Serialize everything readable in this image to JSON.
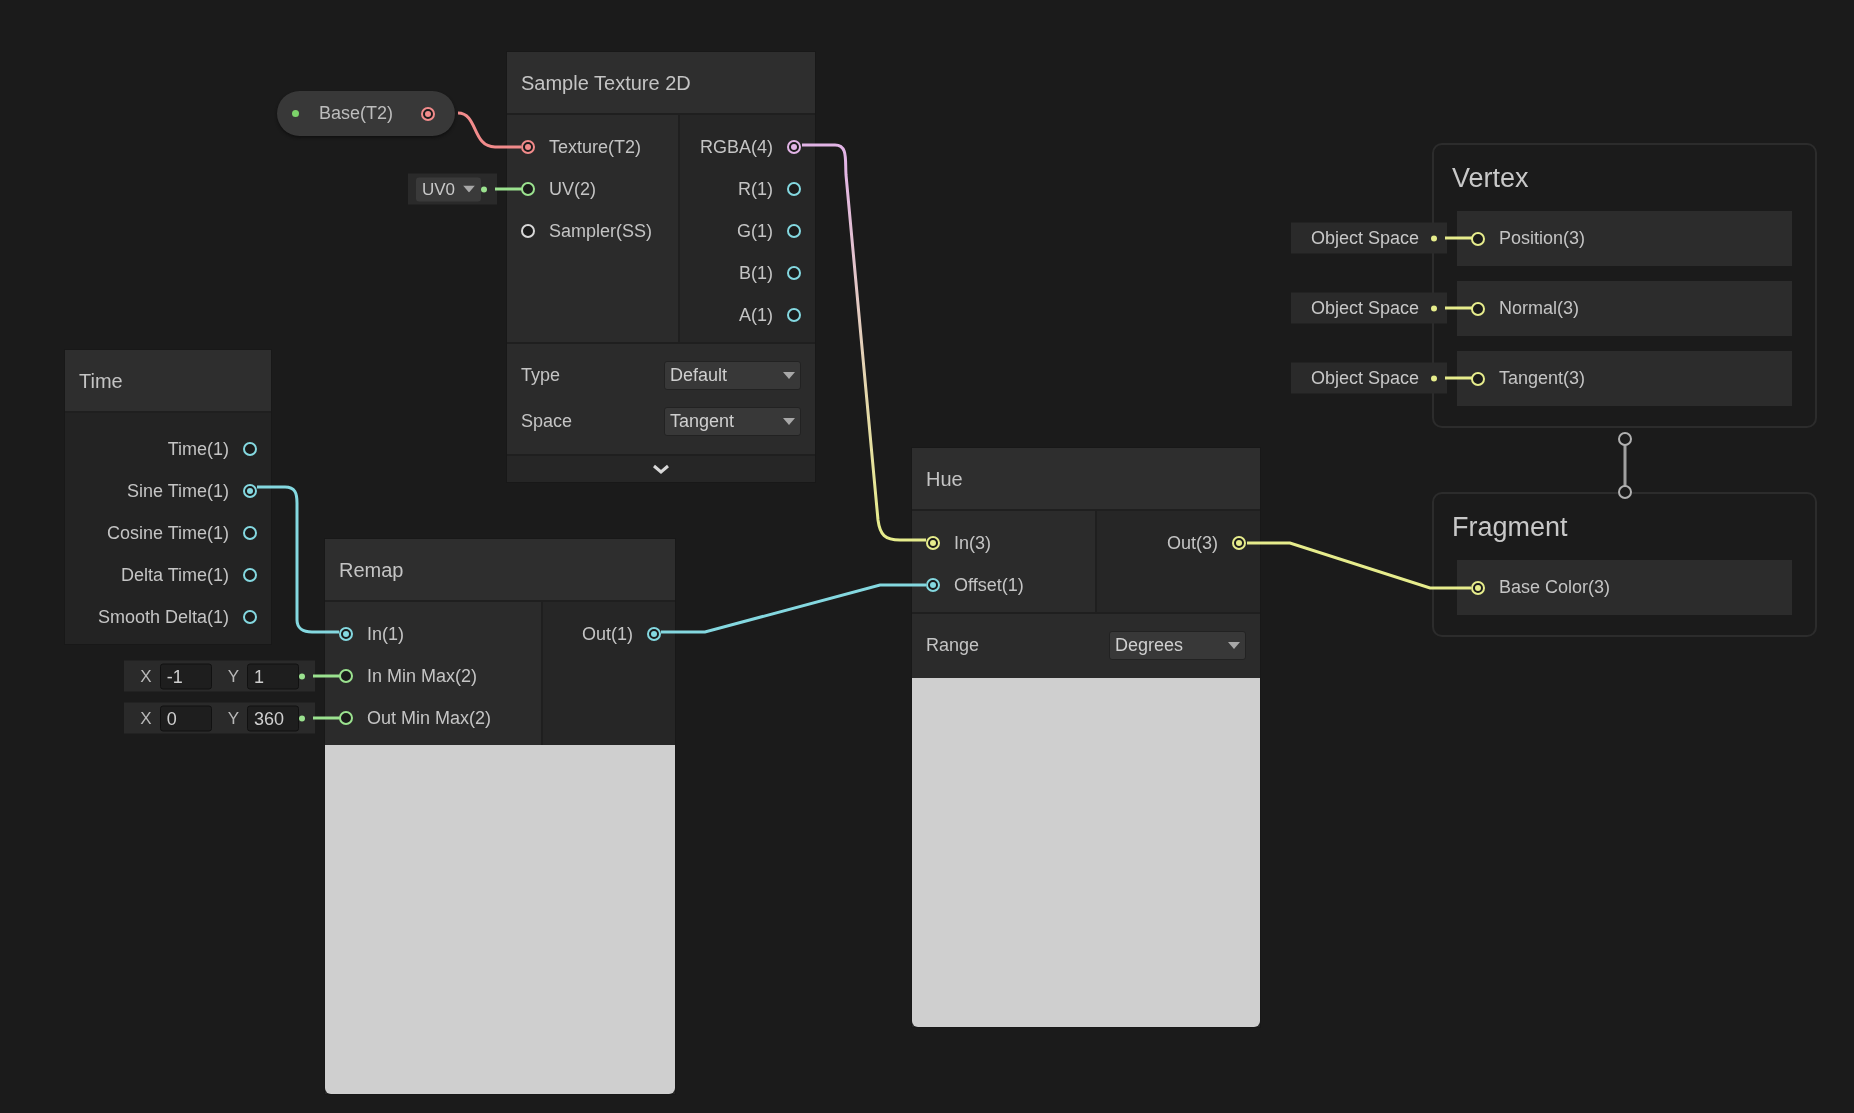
{
  "property_node": {
    "label": "Base(T2)",
    "color": "#f28b8b",
    "connected": true
  },
  "nodes": [
    {
      "title": "Sample Texture 2D",
      "inputs": [
        {
          "label": "Texture(T2)",
          "color": "#f28b8b",
          "connected": true
        },
        {
          "label": "UV(2)",
          "color": "#9be28f",
          "connected": false,
          "default": {
            "kind": "dropdown",
            "value": "UV0"
          }
        },
        {
          "label": "Sampler(SS)",
          "color": "#d8d8d8",
          "connected": false
        }
      ],
      "outputs": [
        {
          "label": "RGBA(4)",
          "color": "#e2b4e6",
          "connected": true
        },
        {
          "label": "R(1)",
          "color": "#84d8e0",
          "connected": false
        },
        {
          "label": "G(1)",
          "color": "#84d8e0",
          "connected": false
        },
        {
          "label": "B(1)",
          "color": "#84d8e0",
          "connected": false
        },
        {
          "label": "A(1)",
          "color": "#84d8e0",
          "connected": false
        }
      ],
      "settings": [
        {
          "label": "Type",
          "value": "Default"
        },
        {
          "label": "Space",
          "value": "Tangent"
        }
      ],
      "more_toggle": true
    },
    {
      "title": "Time",
      "outputs": [
        {
          "label": "Time(1)",
          "color": "#84d8e0",
          "connected": false
        },
        {
          "label": "Sine Time(1)",
          "color": "#84d8e0",
          "connected": true
        },
        {
          "label": "Cosine Time(1)",
          "color": "#84d8e0",
          "connected": false
        },
        {
          "label": "Delta Time(1)",
          "color": "#84d8e0",
          "connected": false
        },
        {
          "label": "Smooth Delta(1)",
          "color": "#84d8e0",
          "connected": false
        }
      ]
    },
    {
      "title": "Remap",
      "inputs": [
        {
          "label": "In(1)",
          "color": "#84d8e0",
          "connected": true
        },
        {
          "label": "In Min Max(2)",
          "color": "#9be28f",
          "connected": false,
          "default": {
            "kind": "vector",
            "fields": [
              {
                "label": "X",
                "value": "-1"
              },
              {
                "label": "Y",
                "value": "1"
              }
            ]
          }
        },
        {
          "label": "Out Min Max(2)",
          "color": "#9be28f",
          "connected": false,
          "default": {
            "kind": "vector",
            "fields": [
              {
                "label": "X",
                "value": "0"
              },
              {
                "label": "Y",
                "value": "360"
              }
            ]
          }
        }
      ],
      "outputs": [
        {
          "label": "Out(1)",
          "color": "#84d8e0",
          "connected": true
        }
      ],
      "preview": true
    },
    {
      "title": "Hue",
      "inputs": [
        {
          "label": "In(3)",
          "color": "#e6ec8c",
          "connected": true
        },
        {
          "label": "Offset(1)",
          "color": "#84d8e0",
          "connected": true
        }
      ],
      "outputs": [
        {
          "label": "Out(3)",
          "color": "#e6ec8c",
          "connected": true
        }
      ],
      "settings": [
        {
          "label": "Range",
          "value": "Degrees"
        }
      ],
      "preview": true
    }
  ],
  "contexts": [
    {
      "title": "Vertex",
      "blocks": [
        {
          "label": "Position(3)",
          "color": "#e6ec8c",
          "connected": false,
          "default": {
            "kind": "label",
            "value": "Object Space"
          }
        },
        {
          "label": "Normal(3)",
          "color": "#e6ec8c",
          "connected": false,
          "default": {
            "kind": "label",
            "value": "Object Space"
          }
        },
        {
          "label": "Tangent(3)",
          "color": "#e6ec8c",
          "connected": false,
          "default": {
            "kind": "label",
            "value": "Object Space"
          }
        }
      ]
    },
    {
      "title": "Fragment",
      "blocks": [
        {
          "label": "Base Color(3)",
          "color": "#e6ec8c",
          "connected": true
        }
      ]
    }
  ]
}
